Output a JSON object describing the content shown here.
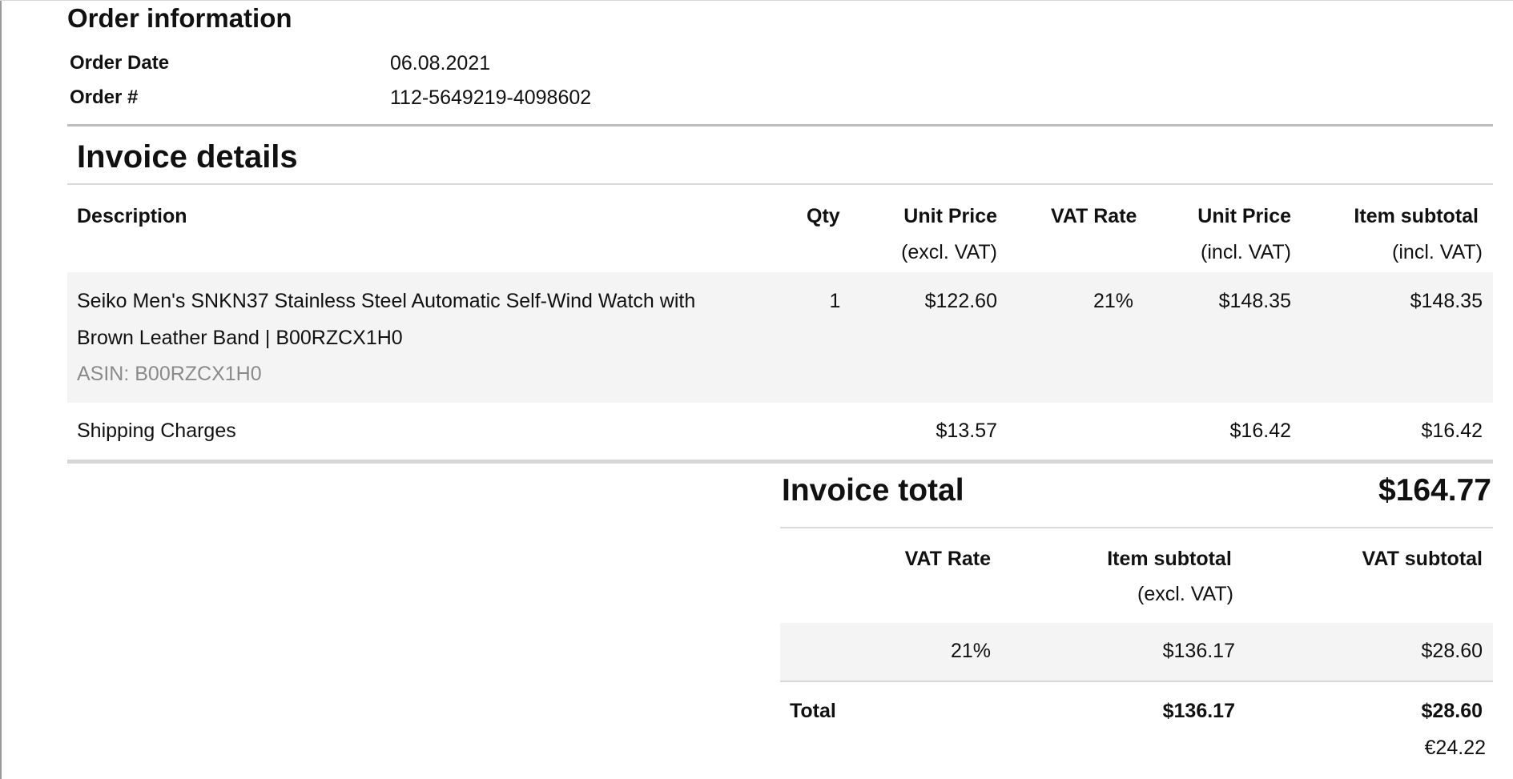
{
  "order_info": {
    "title": "Order information",
    "rows": [
      {
        "label": "Order Date",
        "value": "06.08.2021"
      },
      {
        "label": "Order #",
        "value": "112-5649219-4098602"
      }
    ]
  },
  "invoice": {
    "title": "Invoice details",
    "headers": {
      "description": "Description",
      "qty": "Qty",
      "unit_excl_1": "Unit Price",
      "unit_excl_2": "(excl. VAT)",
      "vat_rate": "VAT Rate",
      "unit_incl_1": "Unit Price",
      "unit_incl_2": "(incl. VAT)",
      "subtotal_1": "Item subtotal",
      "subtotal_2": "(incl. VAT)"
    },
    "item": {
      "desc_line1": "Seiko Men's SNKN37 Stainless Steel Automatic Self-Wind Watch with",
      "desc_line2": "Brown Leather Band | B00RZCX1H0",
      "asin": "ASIN: B00RZCX1H0",
      "qty": "1",
      "unit_excl": "$122.60",
      "vat_rate": "21%",
      "unit_incl": "$148.35",
      "subtotal": "$148.35"
    },
    "shipping": {
      "label": "Shipping Charges",
      "unit_excl": "$13.57",
      "unit_incl": "$16.42",
      "subtotal": "$16.42"
    },
    "total_label": "Invoice total",
    "total_value": "$164.77"
  },
  "vat_summary": {
    "headers": {
      "rate": "VAT Rate",
      "subtotal_1": "Item subtotal",
      "subtotal_2": "(excl. VAT)",
      "vat_subtotal": "VAT subtotal"
    },
    "row": {
      "rate": "21%",
      "subtotal": "$136.17",
      "vat": "$28.60"
    },
    "total": {
      "label": "Total",
      "subtotal": "$136.17",
      "vat": "$28.60",
      "vat_eur": "€24.22"
    }
  }
}
